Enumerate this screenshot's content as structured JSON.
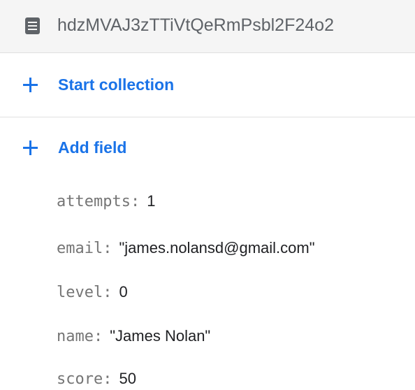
{
  "document": {
    "icon": "document-icon",
    "id": "hdzMVAJ3zTTiVtQeRmPsbl2F24o2"
  },
  "actions": {
    "start_collection": "Start collection",
    "add_field": "Add field",
    "icon": "plus-icon",
    "accent_color": "#1a73e8"
  },
  "fields": [
    {
      "key": "attempts:",
      "value": "1"
    },
    {
      "key": "email:",
      "value": "\"james.nolansd@gmail.com\""
    },
    {
      "key": "level:",
      "value": "0"
    },
    {
      "key": "name:",
      "value": "\"James Nolan\""
    },
    {
      "key": "score:",
      "value": "50"
    }
  ]
}
